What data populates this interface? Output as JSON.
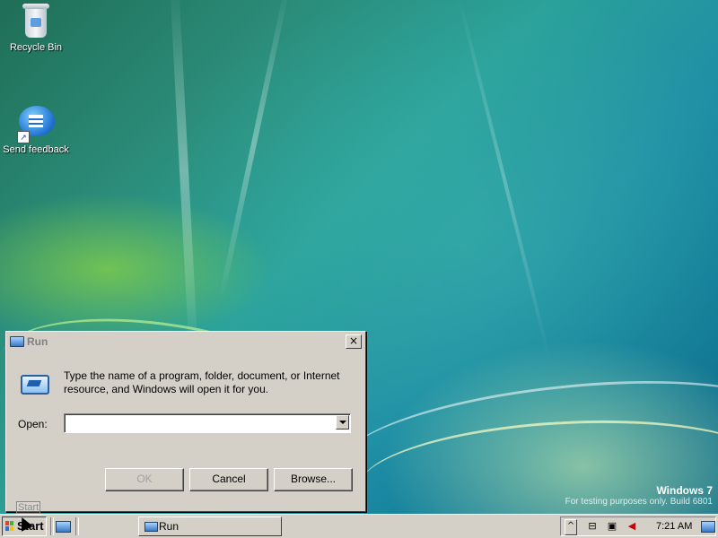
{
  "desktop": {
    "icons": [
      {
        "label": "Recycle Bin",
        "icon": "recycle-bin-icon"
      },
      {
        "label": "Send feedback",
        "icon": "send-feedback-icon"
      }
    ],
    "watermark": {
      "title": "Windows 7",
      "subtitle": "For testing purposes only. Build 6801"
    }
  },
  "run_dialog": {
    "title": "Run",
    "description": "Type the name of a program, folder, document, or Internet resource, and Windows will open it for you.",
    "open_label": "Open:",
    "open_value": "",
    "buttons": {
      "ok": "OK",
      "cancel": "Cancel",
      "browse": "Browse..."
    }
  },
  "tooltip": "Start",
  "taskbar": {
    "start_label": "Start",
    "task_button": "Run",
    "clock": "7:21 AM"
  },
  "colors": {
    "face": "#d4d0c8",
    "wallpaper_teal": "#2aa19a",
    "wallpaper_green": "#96dc3c"
  }
}
